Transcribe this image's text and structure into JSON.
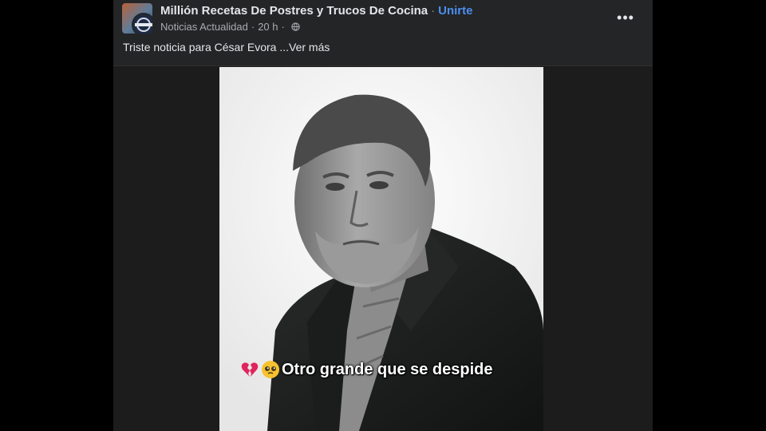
{
  "post": {
    "group_name": "Millión Recetas De Postres y Trucos De Cocina",
    "separator": "·",
    "join_label": "Unirte",
    "author": "Noticias Actualidad",
    "time": "20 h",
    "meta_dot": "·",
    "privacy_icon": "globe-icon",
    "more_label": "•••",
    "text": "Triste noticia para César Evora ",
    "see_more": "...Ver más"
  },
  "photo": {
    "caption": "Otro grande que se despide",
    "caption_emojis": [
      "broken-heart-icon",
      "pleading-face-icon"
    ]
  },
  "colors": {
    "background": "#000000",
    "card": "#242526",
    "text": "#e4e6eb",
    "muted": "#a8abaf",
    "link": "#4b8ef0"
  }
}
